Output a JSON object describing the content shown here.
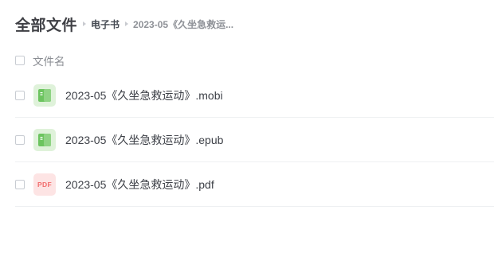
{
  "breadcrumb": {
    "root": "全部文件",
    "parent": "电子书",
    "current": "2023-05《久坐急救运..."
  },
  "list": {
    "header_label": "文件名",
    "files": [
      {
        "name": "2023-05《久坐急救运动》.mobi",
        "icon": "ebook-icon",
        "icon_color": "#5bbd4e"
      },
      {
        "name": "2023-05《久坐急救运动》.epub",
        "icon": "ebook-icon",
        "icon_color": "#5bbd4e"
      },
      {
        "name": "2023-05《久坐急救运动》.pdf",
        "icon": "pdf-icon",
        "icon_label": "PDF",
        "icon_color": "#f26d6d"
      }
    ]
  }
}
